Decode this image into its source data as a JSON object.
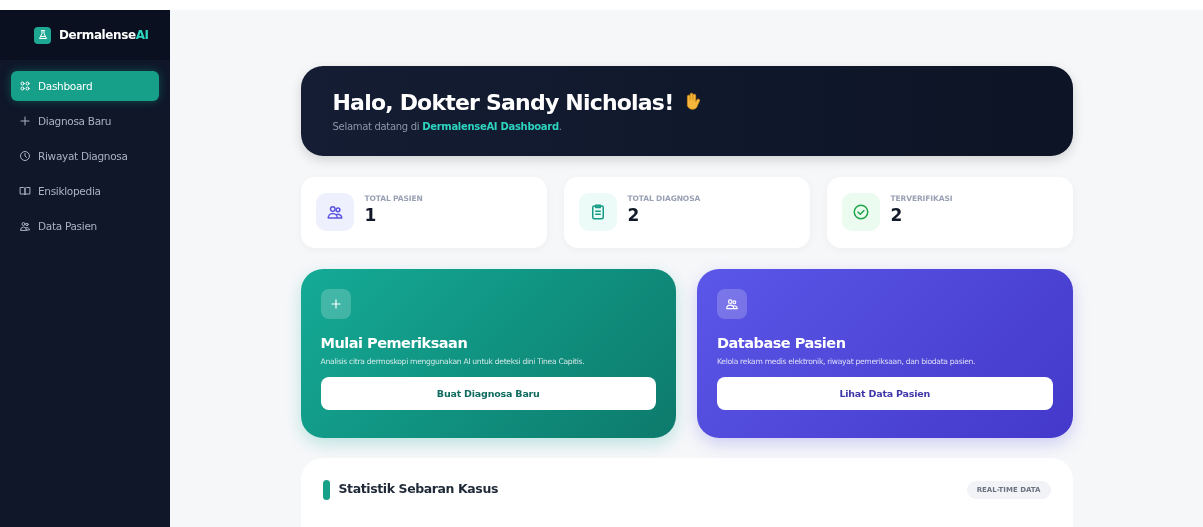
{
  "brand": {
    "name": "Dermalense",
    "accent": "AI"
  },
  "sidebar": {
    "items": [
      {
        "label": "Dashboard",
        "kind": "grid",
        "selected": true
      },
      {
        "label": "Diagnosa Baru",
        "kind": "plus",
        "selected": false
      },
      {
        "label": "Riwayat Diagnosa",
        "kind": "clock",
        "selected": false
      },
      {
        "label": "Ensiklopedia",
        "kind": "book",
        "selected": false
      },
      {
        "label": "Data Pasien",
        "kind": "users",
        "selected": false
      }
    ]
  },
  "banner": {
    "title": "Halo, Dokter Sandy Nicholas!",
    "subtitle": "Selamat datang di **DermalenseAI Dashboard**."
  },
  "stats": [
    {
      "label": "TOTAL PASIEN",
      "value": "1",
      "kind": "users"
    },
    {
      "label": "TOTAL DIAGNOSA",
      "value": "2",
      "kind": "clipboard"
    },
    {
      "label": "TERVERIFIKASI",
      "value": "2",
      "kind": "check"
    }
  ],
  "actions": [
    {
      "kind": "teal",
      "title": "Mulai Pemeriksaan",
      "description": "Analisis citra dermoskopi menggunakan AI untuk deteksi dini Tinea Capitis.",
      "button": "Buat Diagnosa Baru"
    },
    {
      "kind": "indigo",
      "title": "Database Pasien",
      "description": "Kelola rekam medis elektronik, riwayat pemeriksaan, dan biodata pasien.",
      "button": "Lihat Data Pasien"
    }
  ],
  "statistics": {
    "title": "Statistik Sebaran Kasus",
    "badge": "REAL-TIME DATA"
  }
}
